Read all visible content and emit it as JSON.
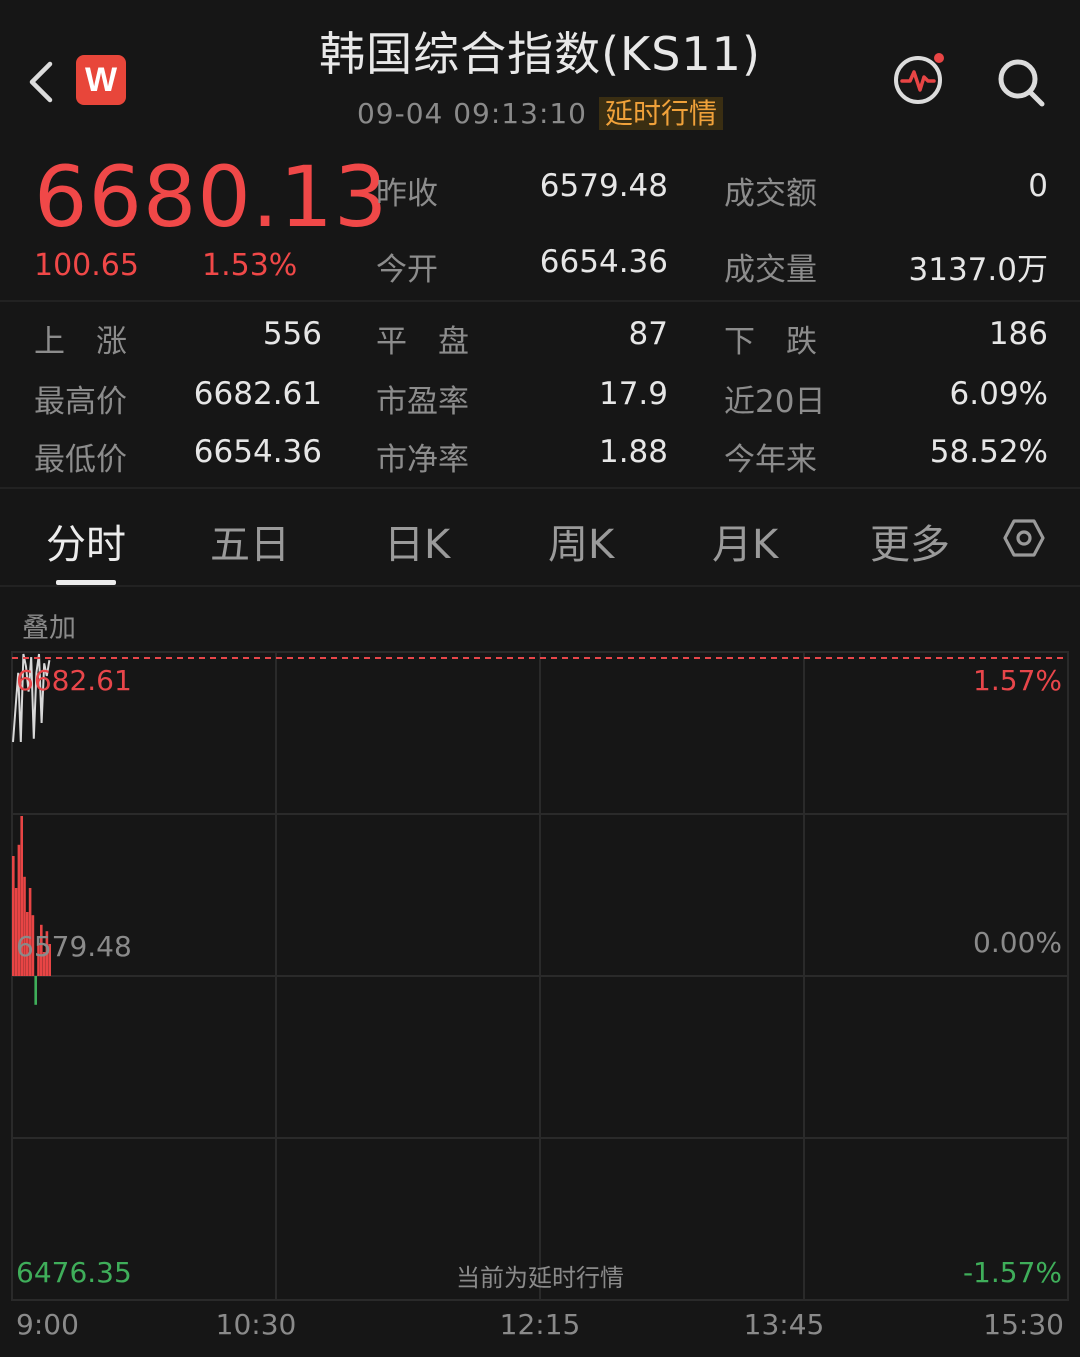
{
  "header": {
    "title": "韩国综合指数(KS11)",
    "timestamp": "09-04 09:13:10",
    "delay_badge": "延时行情",
    "logo_letter": "W"
  },
  "quote": {
    "price": "6680.13",
    "change": "100.65",
    "change_pct": "1.53%",
    "prev_close_label": "昨收",
    "prev_close": "6579.48",
    "turnover_label": "成交额",
    "turnover": "0",
    "open_label": "今开",
    "open": "6654.36",
    "volume_label": "成交量",
    "volume": "3137.0万"
  },
  "stats": {
    "up_label": "上　涨",
    "up": "556",
    "flat_label": "平　盘",
    "flat": "87",
    "down_label": "下　跌",
    "down": "186",
    "high_label": "最高价",
    "high": "6682.61",
    "pe_label": "市盈率",
    "pe": "17.9",
    "d20_label": "近20日",
    "d20": "6.09%",
    "low_label": "最低价",
    "low": "6654.36",
    "pb_label": "市净率",
    "pb": "1.88",
    "ytd_label": "今年来",
    "ytd": "58.52%"
  },
  "tabs": [
    {
      "label": "分时",
      "active": true
    },
    {
      "label": "五日"
    },
    {
      "label": "日K"
    },
    {
      "label": "周K"
    },
    {
      "label": "月K"
    },
    {
      "label": "更多"
    }
  ],
  "overlay_label": "叠加",
  "chart_data": {
    "type": "line",
    "y_left_labels": [
      "6682.61",
      "6579.48",
      "6476.35"
    ],
    "y_right_labels": [
      "1.57%",
      "0.00%",
      "-1.57%"
    ],
    "x_labels": [
      "9:00",
      "10:30",
      "12:15",
      "13:45",
      "15:30"
    ],
    "ylim": [
      6476.35,
      6682.61
    ],
    "base": 6579.48,
    "price_series": [
      6630,
      6665,
      6676,
      6650,
      6682,
      6678,
      6670,
      6681,
      6655,
      6676,
      6682,
      6660,
      6679,
      6675,
      6680
    ],
    "volume_bars": [
      0.75,
      0.55,
      0.82,
      1.0,
      0.62,
      0.4,
      0.55,
      0.38,
      -0.18,
      0.2,
      0.32,
      0.15,
      0.28,
      0.2
    ],
    "watermark": "当前为延时行情",
    "colors": {
      "up": "#e84545",
      "down": "#3fae5a",
      "line": "#d8d8d8",
      "ref": "#e8464a"
    }
  }
}
